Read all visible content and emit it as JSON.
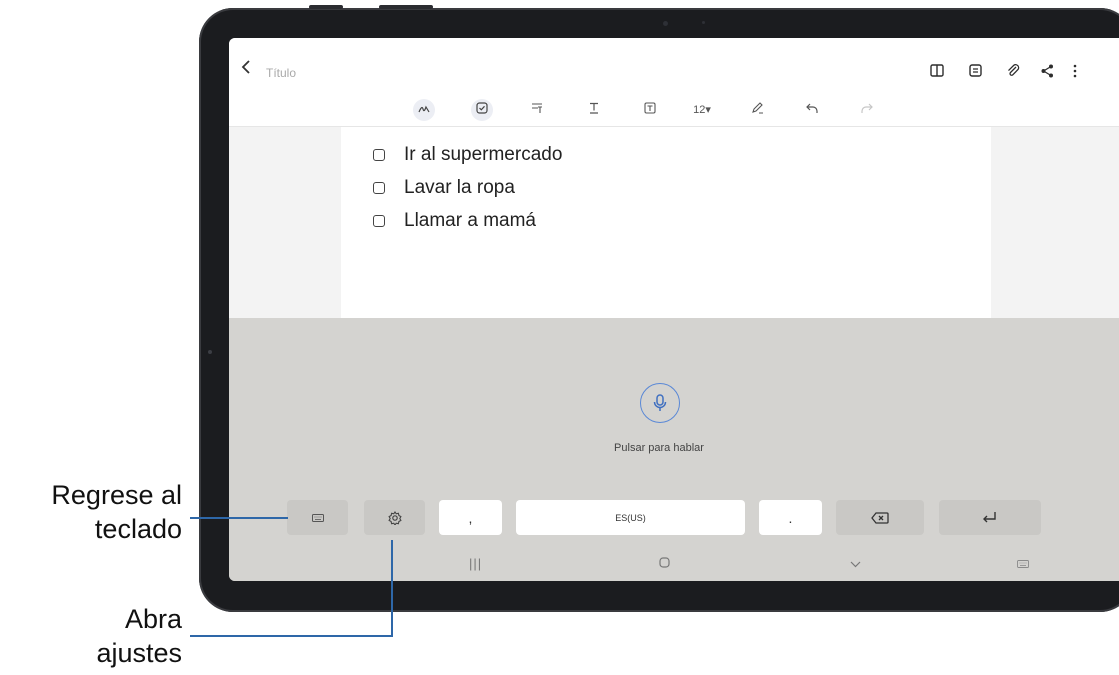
{
  "app": {
    "back_icon": "chevron-left-icon",
    "title_placeholder": "Título",
    "toolbar_right": [
      {
        "name": "book-view-icon",
        "glyph": "◫"
      },
      {
        "name": "page-view-icon",
        "glyph": "▤"
      },
      {
        "name": "attach-icon",
        "glyph": "⌀"
      },
      {
        "name": "share-icon",
        "glyph": "<"
      },
      {
        "name": "more-options-icon",
        "glyph": "⋮"
      }
    ]
  },
  "toolbar": {
    "font_size": "12▾",
    "tools": [
      {
        "name": "handwriting-icon",
        "glyph": "✍"
      },
      {
        "name": "checklist-icon",
        "glyph": "☑"
      },
      {
        "name": "text-format-icon",
        "glyph": "⩶"
      },
      {
        "name": "text-style-icon",
        "glyph": "T̲"
      },
      {
        "name": "text-box-icon",
        "glyph": "⊡"
      },
      {
        "name": "pen-color-icon",
        "glyph": "✎"
      },
      {
        "name": "undo-icon",
        "glyph": "↶"
      },
      {
        "name": "redo-icon",
        "glyph": "↷"
      }
    ]
  },
  "note": {
    "items": [
      "Ir al supermercado",
      "Lavar la ropa",
      "Llamar a mamá"
    ]
  },
  "voice": {
    "mic_icon": "microphone-icon",
    "hint": "Pulsar para hablar"
  },
  "keyboard": {
    "comma": ",",
    "language": "ES(US)",
    "period": "."
  },
  "navbar": {
    "recents": "|||",
    "home": "○",
    "back": "∨",
    "keyboard": "⌨"
  },
  "callouts": {
    "keyboard_line1": "Regrese al",
    "keyboard_line2": "teclado",
    "settings_line1": "Abra",
    "settings_line2": "ajustes"
  },
  "colors": {
    "accent": "#2e67a8",
    "mic_ring": "#5a88d6",
    "panel": "#d4d3d0"
  }
}
